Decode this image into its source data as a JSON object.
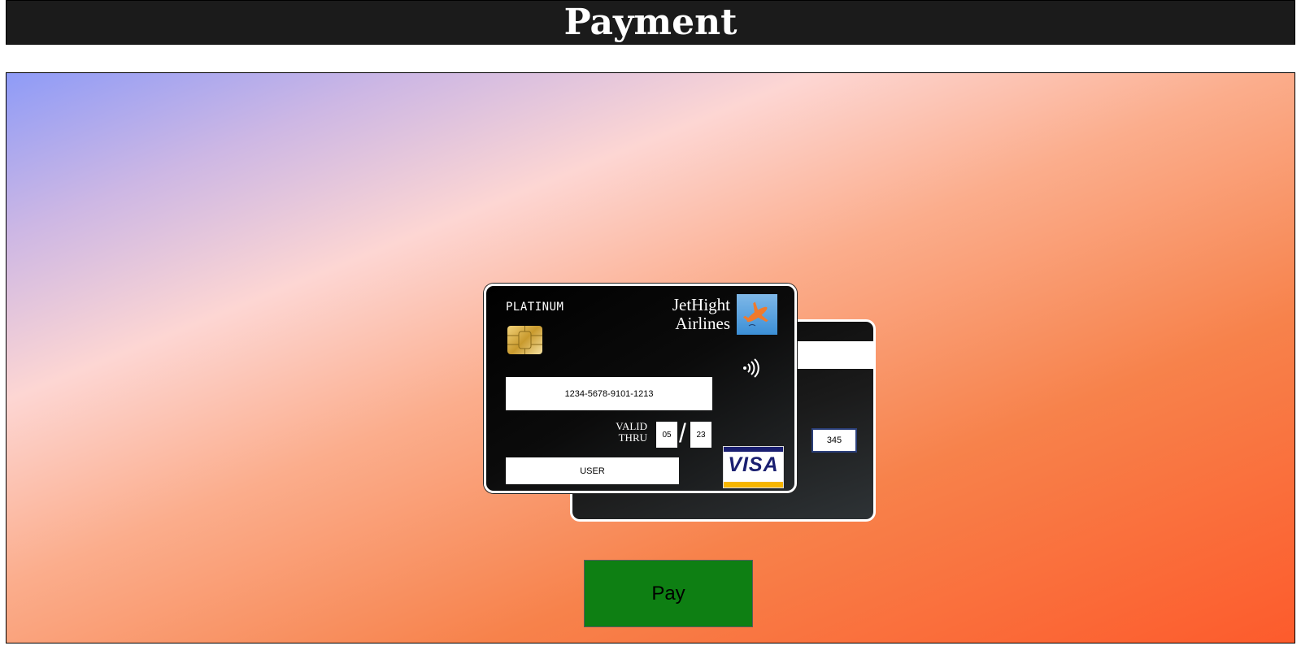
{
  "page": {
    "title": "Payment"
  },
  "card": {
    "tier": "PLATINUM",
    "airline_line1": "JetHight",
    "airline_line2": "Airlines",
    "number": "1234-5678-9101-1213",
    "valid_line1": "VALID",
    "valid_line2": "THRU",
    "exp_month": "05",
    "exp_separator": "/",
    "exp_year": "23",
    "holder": "USER",
    "network": "VISA",
    "cvv": "345"
  },
  "actions": {
    "pay_label": "Pay"
  },
  "colors": {
    "header_bg": "#1b1b1b",
    "pay_button": "#0e7f13",
    "visa_blue": "#1a1f71",
    "visa_gold": "#f7b600"
  },
  "icons": [
    "airplane-logo-icon",
    "chip-icon",
    "contactless-icon",
    "visa-logo-icon"
  ]
}
